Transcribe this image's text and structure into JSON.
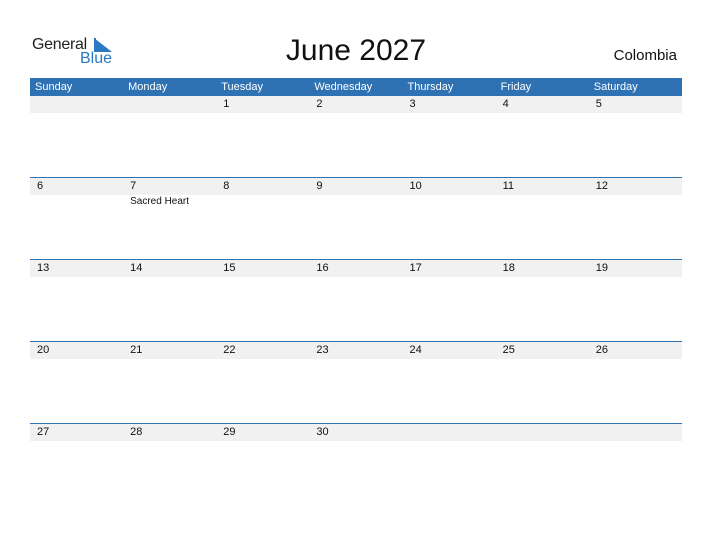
{
  "logo": {
    "word1": "General",
    "word2": "Blue"
  },
  "title": "June 2027",
  "country": "Colombia",
  "weekdays": [
    "Sunday",
    "Monday",
    "Tuesday",
    "Wednesday",
    "Thursday",
    "Friday",
    "Saturday"
  ],
  "weeks": [
    {
      "days": [
        "",
        "",
        "1",
        "2",
        "3",
        "4",
        "5"
      ],
      "events": [
        "",
        "",
        "",
        "",
        "",
        "",
        ""
      ]
    },
    {
      "days": [
        "6",
        "7",
        "8",
        "9",
        "10",
        "11",
        "12"
      ],
      "events": [
        "",
        "Sacred Heart",
        "",
        "",
        "",
        "",
        ""
      ]
    },
    {
      "days": [
        "13",
        "14",
        "15",
        "16",
        "17",
        "18",
        "19"
      ],
      "events": [
        "",
        "",
        "",
        "",
        "",
        "",
        ""
      ]
    },
    {
      "days": [
        "20",
        "21",
        "22",
        "23",
        "24",
        "25",
        "26"
      ],
      "events": [
        "",
        "",
        "",
        "",
        "",
        "",
        ""
      ]
    },
    {
      "days": [
        "27",
        "28",
        "29",
        "30",
        "",
        "",
        ""
      ],
      "events": [
        "",
        "",
        "",
        "",
        "",
        "",
        ""
      ]
    }
  ],
  "colors": {
    "accent": "#2e72b4",
    "logo_blue": "#2a79c2",
    "date_row_bg": "#f1f1f1"
  }
}
